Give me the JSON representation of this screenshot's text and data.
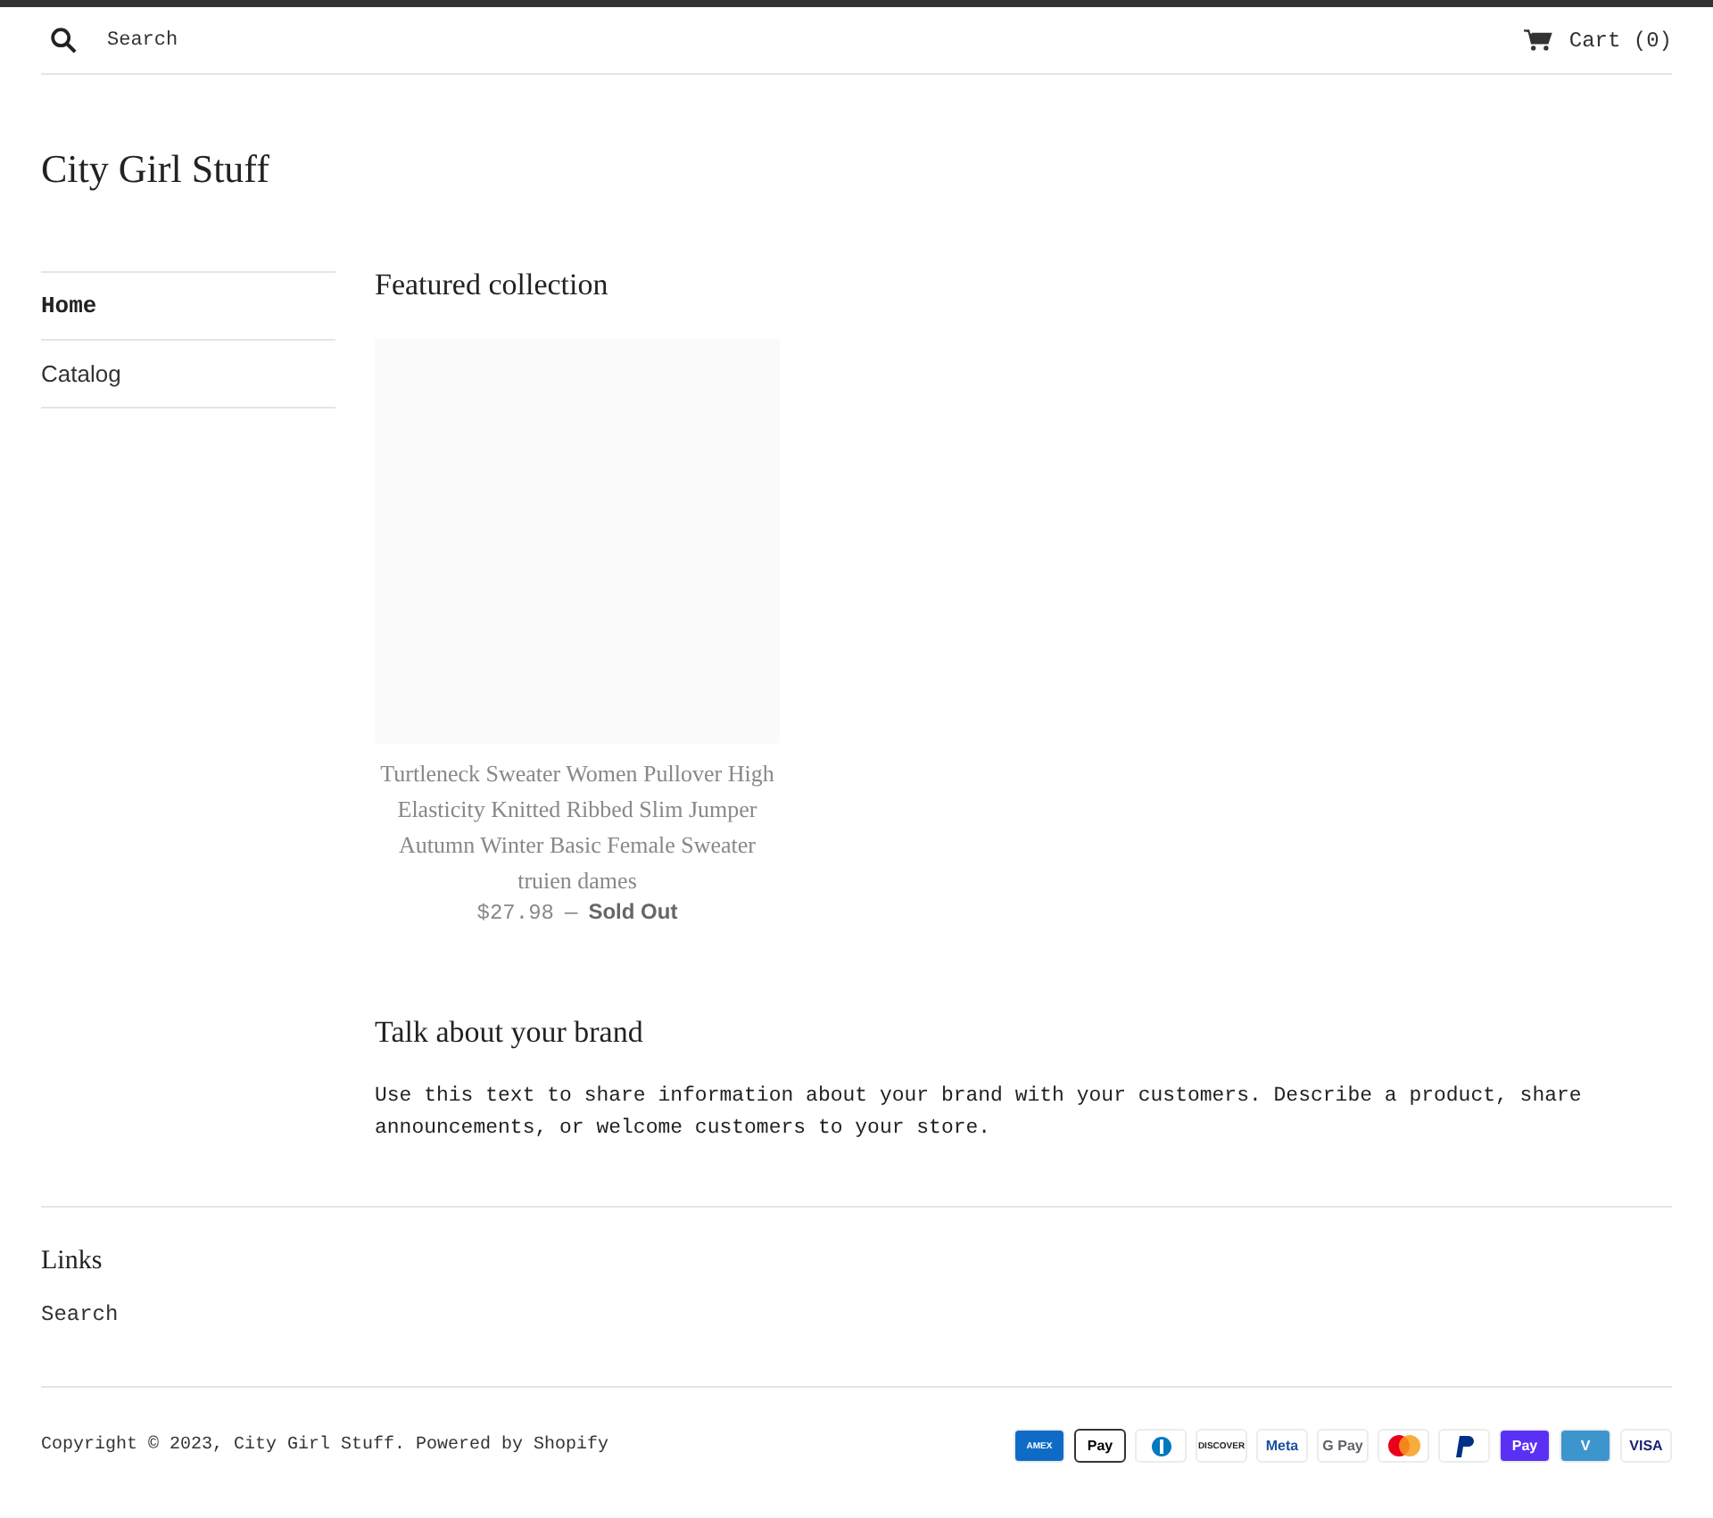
{
  "header": {
    "search_placeholder": "Search",
    "cart": "Cart (0)"
  },
  "logo": "City Girl Stuff",
  "sidebar": {
    "items": [
      {
        "label": "Home",
        "selected": true
      },
      {
        "label": "Catalog",
        "selected": false
      }
    ]
  },
  "featured": {
    "title": "Featured collection",
    "products": [
      {
        "title": "Turtleneck Sweater Women Pullover High Elasticity Knitted Ribbed Slim Jumper Autumn Winter Basic Female Sweater truien dames",
        "price": "$27.98",
        "separator": "—",
        "status": "Sold Out"
      }
    ]
  },
  "brand": {
    "title": "Talk about your brand",
    "text": "Use this text to share information about your brand with your customers. Describe a product, share announcements, or welcome customers to your store."
  },
  "footer": {
    "links_title": "Links",
    "links": [
      "Search"
    ],
    "copyright": "Copyright © 2023, City Girl Stuff. Powered by Shopify",
    "payments": [
      {
        "kind": "amex",
        "label": "AMEX"
      },
      {
        "kind": "apple",
        "label": "Pay"
      },
      {
        "kind": "diners"
      },
      {
        "kind": "discover",
        "label": "DISCOVER"
      },
      {
        "kind": "meta",
        "label": "Meta"
      },
      {
        "kind": "gpay",
        "label": "G Pay"
      },
      {
        "kind": "mastercard"
      },
      {
        "kind": "paypal"
      },
      {
        "kind": "shoppay",
        "label": "Pay"
      },
      {
        "kind": "venmo",
        "label": "V"
      },
      {
        "kind": "visa",
        "label": "VISA"
      }
    ]
  }
}
